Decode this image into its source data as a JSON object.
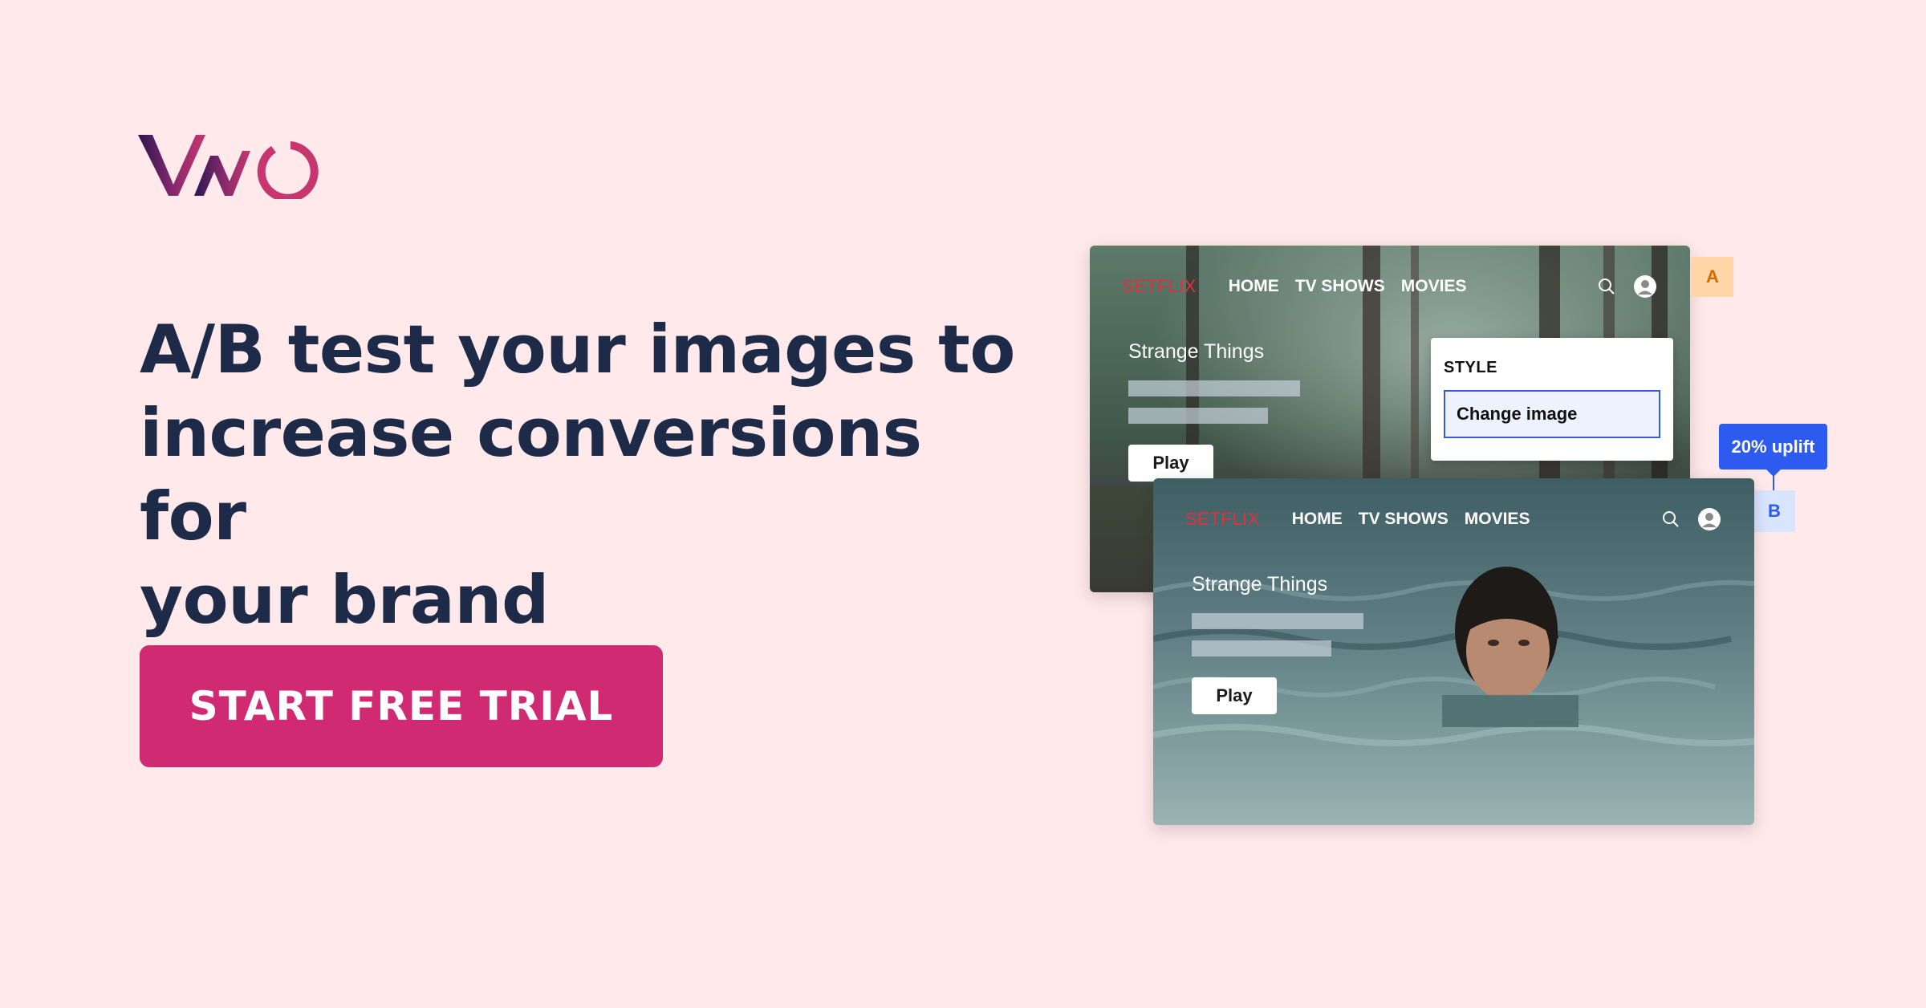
{
  "logo": {
    "text": "VWO",
    "colors": [
      "#2b1651",
      "#8a2a6e",
      "#c8366f"
    ]
  },
  "headline": {
    "line1": "A/B test your images to",
    "line2": "increase conversions for",
    "line3": "your brand"
  },
  "cta": {
    "label": "START FREE TRIAL",
    "color": "#cf2a72"
  },
  "variant_a": {
    "tag": "A",
    "brand": "SETFLIX",
    "nav": [
      "HOME",
      "TV SHOWS",
      "MOVIES"
    ],
    "show_title": "Strange Things",
    "play_label": "Play",
    "background": "forest"
  },
  "style_panel": {
    "heading": "STYLE",
    "action": "Change image"
  },
  "variant_b": {
    "tag": "B",
    "uplift": "20% uplift",
    "brand": "SETFLIX",
    "nav": [
      "HOME",
      "TV SHOWS",
      "MOVIES"
    ],
    "show_title": "Strange Things",
    "play_label": "Play",
    "background": "swimmer-in-water"
  },
  "icons": [
    "search-icon",
    "user-icon"
  ]
}
